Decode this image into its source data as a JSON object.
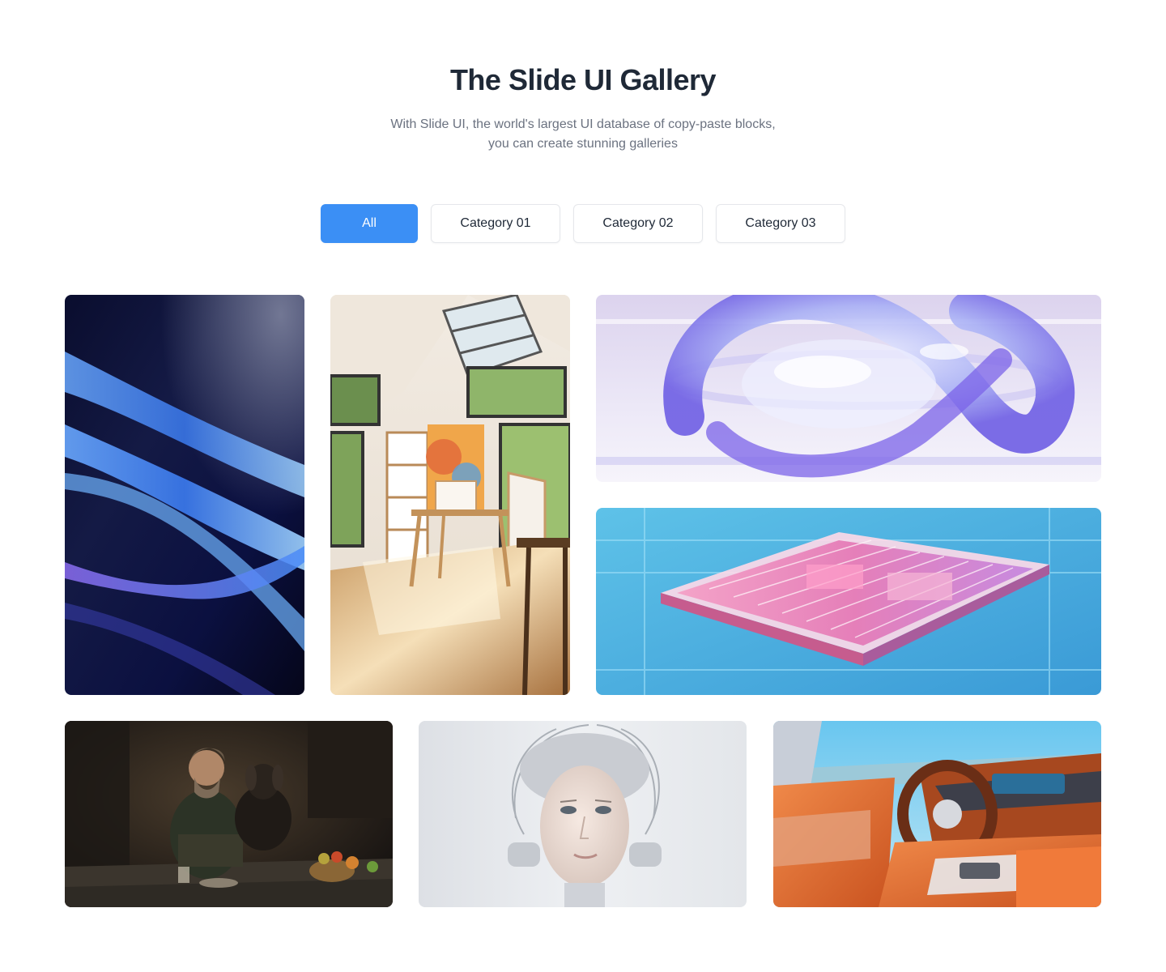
{
  "header": {
    "title": "The Slide UI Gallery",
    "subtitle_line1": "With Slide UI, the world's largest UI database of copy-paste blocks,",
    "subtitle_line2": "you can create stunning galleries"
  },
  "filters": {
    "active": "All",
    "items": [
      {
        "label": "All"
      },
      {
        "label": "Category 01"
      },
      {
        "label": "Category 02"
      },
      {
        "label": "Category 03"
      }
    ]
  },
  "colors": {
    "accent": "#3b8ff5",
    "title": "#1f2937",
    "subtitle": "#6b7280",
    "border": "#e5e7eb"
  },
  "gallery": {
    "images": [
      {
        "name": "blue-abstract-waves"
      },
      {
        "name": "sunlit-art-studio"
      },
      {
        "name": "glass-ring-sculpture"
      },
      {
        "name": "circuit-chip"
      },
      {
        "name": "man-with-dog"
      },
      {
        "name": "robot-woman"
      },
      {
        "name": "car-interior"
      }
    ]
  }
}
